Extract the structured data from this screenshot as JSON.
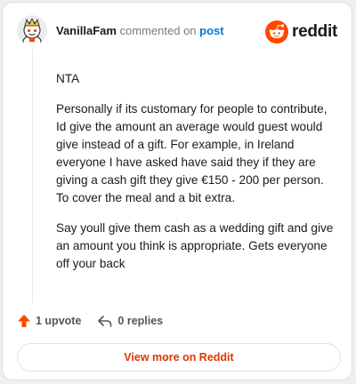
{
  "header": {
    "username": "VanillaFam",
    "commented_on": "commented on",
    "post_link": "post",
    "brand": "reddit"
  },
  "comment": {
    "paragraphs": [
      "NTA",
      "Personally if its customary for people to contribute, Id give the amount an average would guest would give instead of a gift. For example, in Ireland everyone I have asked have said they if they are giving a cash gift they give €150 - 200 per person. To cover the meal and a bit extra.",
      "Say youll give them cash as a wedding gift and give an amount you think is appropriate. Gets everyone off your back"
    ]
  },
  "actions": {
    "upvote": "1 upvote",
    "replies": "0 replies"
  },
  "footer": {
    "view_more": "View more on Reddit"
  },
  "colors": {
    "brand_orange": "#ff4500",
    "link_blue": "#0079d3",
    "view_more_text": "#d93a00"
  }
}
